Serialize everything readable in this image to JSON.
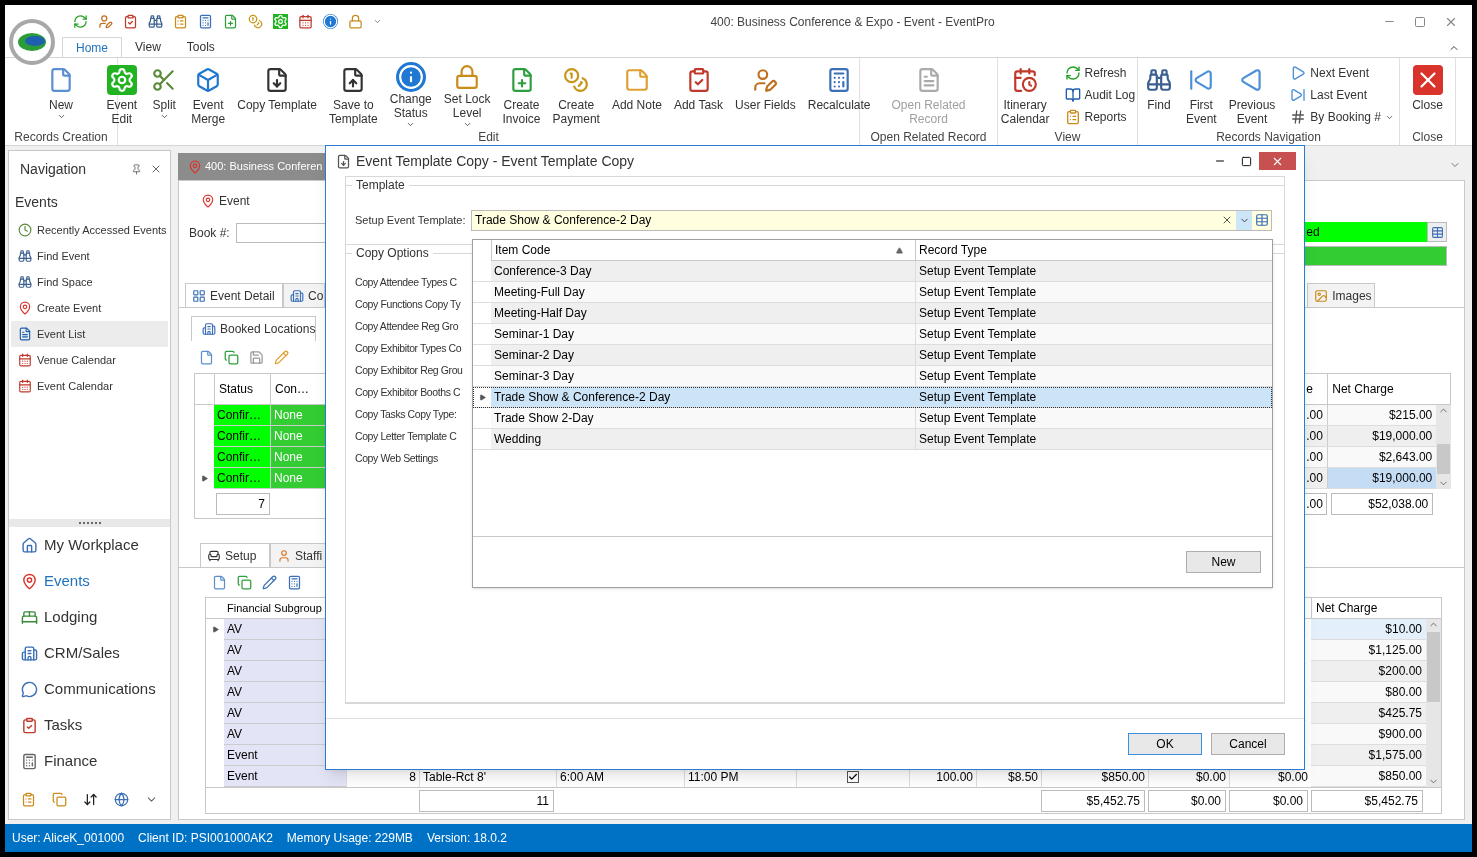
{
  "window": {
    "title": "400: Business Conference & Expo - Event - EventPro"
  },
  "ribbon_tabs": [
    {
      "label": "Home",
      "selected": true
    },
    {
      "label": "View",
      "selected": false
    },
    {
      "label": "Tools",
      "selected": false
    }
  ],
  "ribbon_groups": [
    {
      "label": "Records Creation",
      "buttons": [
        {
          "label": "New",
          "kind": "large",
          "dropdown": true,
          "disabled": false
        }
      ]
    },
    {
      "label": "Edit",
      "buttons": [
        {
          "label": "Event\nEdit",
          "kind": "large",
          "dropdown": false,
          "disabled": false
        },
        {
          "label": "Split",
          "kind": "large",
          "dropdown": true,
          "disabled": false
        },
        {
          "label": "Event\nMerge",
          "kind": "large",
          "dropdown": false,
          "disabled": false
        },
        {
          "label": "Copy Template",
          "kind": "large",
          "dropdown": false,
          "disabled": false
        },
        {
          "label": "Save to\nTemplate",
          "kind": "large",
          "dropdown": false,
          "disabled": false
        },
        {
          "label": "Change\nStatus",
          "kind": "large",
          "dropdown": true,
          "disabled": false
        },
        {
          "label": "Set Lock\nLevel",
          "kind": "large",
          "dropdown": true,
          "disabled": false
        },
        {
          "label": "Create\nInvoice",
          "kind": "large",
          "dropdown": false,
          "disabled": false
        },
        {
          "label": "Create\nPayment",
          "kind": "large",
          "dropdown": false,
          "disabled": false
        },
        {
          "label": "Add Note",
          "kind": "large",
          "dropdown": false,
          "disabled": false
        },
        {
          "label": "Add Task",
          "kind": "large",
          "dropdown": false,
          "disabled": false
        },
        {
          "label": "User Fields",
          "kind": "large",
          "dropdown": false,
          "disabled": false
        },
        {
          "label": "Recalculate",
          "kind": "large",
          "dropdown": false,
          "disabled": false
        }
      ]
    },
    {
      "label": "Open Related Record",
      "buttons": [
        {
          "label": "Open Related\nRecord",
          "kind": "large",
          "dropdown": false,
          "disabled": true
        }
      ]
    },
    {
      "label": "View",
      "buttons": [
        {
          "label": "Itinerary\nCalendar",
          "kind": "large",
          "dropdown": false,
          "disabled": false
        },
        {
          "label": "Refresh",
          "kind": "small",
          "dropdown": false,
          "disabled": false
        },
        {
          "label": "Audit Log",
          "kind": "small",
          "dropdown": false,
          "disabled": false
        },
        {
          "label": "Reports",
          "kind": "small",
          "dropdown": false,
          "disabled": false
        }
      ]
    },
    {
      "label": "Records Navigation",
      "buttons": [
        {
          "label": "Find",
          "kind": "large",
          "dropdown": false,
          "disabled": false
        },
        {
          "label": "First\nEvent",
          "kind": "large",
          "dropdown": false,
          "disabled": false
        },
        {
          "label": "Previous\nEvent",
          "kind": "large",
          "dropdown": false,
          "disabled": false
        },
        {
          "label": "Next Event",
          "kind": "small",
          "dropdown": false,
          "disabled": false
        },
        {
          "label": "Last Event",
          "kind": "small",
          "dropdown": false,
          "disabled": false
        },
        {
          "label": "By Booking #",
          "kind": "small",
          "dropdown": true,
          "disabled": false
        }
      ]
    },
    {
      "label": "Close",
      "buttons": [
        {
          "label": "Close",
          "kind": "large",
          "dropdown": false,
          "disabled": false
        }
      ]
    }
  ],
  "navigation": {
    "title": "Navigation",
    "section": "Events",
    "items": [
      {
        "label": "Recently Accessed Events",
        "selected": false
      },
      {
        "label": "Find Event",
        "selected": false
      },
      {
        "label": "Find Space",
        "selected": false
      },
      {
        "label": "Create Event",
        "selected": false
      },
      {
        "label": "Event List",
        "selected": true
      },
      {
        "label": "Venue Calendar",
        "selected": false
      },
      {
        "label": "Event Calendar",
        "selected": false
      }
    ],
    "modules": [
      {
        "label": "My Workplace",
        "selected": false
      },
      {
        "label": "Events",
        "selected": true
      },
      {
        "label": "Lodging",
        "selected": false
      },
      {
        "label": "CRM/Sales",
        "selected": false
      },
      {
        "label": "Communications",
        "selected": false
      },
      {
        "label": "Tasks",
        "selected": false
      },
      {
        "label": "Finance",
        "selected": false
      }
    ]
  },
  "document": {
    "tab": "400: Business Conferen",
    "event_group": {
      "title": "Event",
      "book_label": "Book #:",
      "status_value": "ed"
    },
    "tabs": [
      {
        "label": "Event Detail",
        "selected": true
      },
      {
        "label": "Co",
        "selected": false
      },
      {
        "label": "Images",
        "selected": false
      }
    ],
    "inner_tab": "Booked Locations",
    "locations": {
      "columns": [
        "Status",
        "Con…",
        "e",
        "Net Charge"
      ],
      "rows": [
        {
          "status": "Confir…",
          "con": "None",
          "partial": ".00",
          "net": "$215.00",
          "current": false
        },
        {
          "status": "Confir…",
          "con": "None",
          "partial": ".00",
          "net": "$19,000.00",
          "current": false
        },
        {
          "status": "Confir…",
          "con": "None",
          "partial": ".00",
          "net": "$2,643.00",
          "current": false
        },
        {
          "status": "Confir…",
          "con": "None",
          "partial": ".00",
          "net": "$19,000.00",
          "current": true
        }
      ],
      "count": "7",
      "total_partial": ".00",
      "total": "$52,038.00"
    },
    "lower_tabs": [
      {
        "label": "Setup",
        "selected": true
      },
      {
        "label": "Staffi",
        "selected": false
      }
    ],
    "charges": {
      "columns": [
        "Financial Subgroup",
        "Net Charge"
      ],
      "rows": [
        {
          "subgroup": "AV",
          "net": "$10.00",
          "current": true
        },
        {
          "subgroup": "AV",
          "net": "$1,125.00",
          "current": false
        },
        {
          "subgroup": "AV",
          "net": "$200.00",
          "current": false
        },
        {
          "subgroup": "AV",
          "net": "$80.00",
          "current": false
        },
        {
          "subgroup": "AV",
          "net": "$425.75",
          "current": false
        },
        {
          "subgroup": "AV",
          "net": "$900.00",
          "current": false
        },
        {
          "subgroup": "Event",
          "net": "$1,575.00",
          "current": false
        },
        {
          "subgroup": "Event",
          "net": "$850.00",
          "current": false,
          "detail": {
            "cells": [
              "8",
              "Table-Rct 8'",
              "6:00 AM",
              "11:00 PM"
            ],
            "checked": true,
            "amounts": [
              "100.00",
              "$8.50",
              "$850.00",
              "$0.00",
              "$0.00"
            ]
          }
        }
      ],
      "totals": {
        "count": "11",
        "amounts": [
          "$5,452.75",
          "$0.00",
          "$0.00",
          "$5,452.75"
        ]
      }
    }
  },
  "dialog": {
    "title": "Event Template Copy - Event Template Copy",
    "template_group": "Template",
    "template_label": "Setup Event Template:",
    "template_value": "Trade Show & Conference-2 Day",
    "options_group": "Copy Options",
    "options": [
      "Copy Attendee Types C",
      "Copy Functions Copy Ty",
      "Copy Attendee Reg Gro",
      "Copy Exhibitor Types Co",
      "Copy Exhibitor Reg Grou",
      "Copy Exhibitor Booths C",
      "Copy Tasks Copy Type:",
      "Copy Letter Template C",
      "Copy Web Settings"
    ],
    "popup": {
      "columns": [
        "Item Code",
        "Record Type"
      ],
      "rows": [
        {
          "code": "Conference-3 Day",
          "type": "Setup Event Template",
          "selected": false
        },
        {
          "code": "Meeting-Full Day",
          "type": "Setup Event Template",
          "selected": false
        },
        {
          "code": "Meeting-Half Day",
          "type": "Setup Event Template",
          "selected": false
        },
        {
          "code": "Seminar-1 Day",
          "type": "Setup Event Template",
          "selected": false
        },
        {
          "code": "Seminar-2 Day",
          "type": "Setup Event Template",
          "selected": false
        },
        {
          "code": "Seminar-3 Day",
          "type": "Setup Event Template",
          "selected": false
        },
        {
          "code": "Trade Show & Conference-2 Day",
          "type": "Setup Event Template",
          "selected": true
        },
        {
          "code": "Trade Show 2-Day",
          "type": "Setup Event Template",
          "selected": false
        },
        {
          "code": "Wedding",
          "type": "Setup Event Template",
          "selected": false
        }
      ],
      "new_button": "New"
    },
    "buttons": [
      "OK",
      "Cancel"
    ]
  },
  "status_bar": [
    "User: AliceK_001000",
    "Client ID: PSI001000AK2",
    "Memory Usage: 229MB",
    "Version: 18.0.2"
  ]
}
